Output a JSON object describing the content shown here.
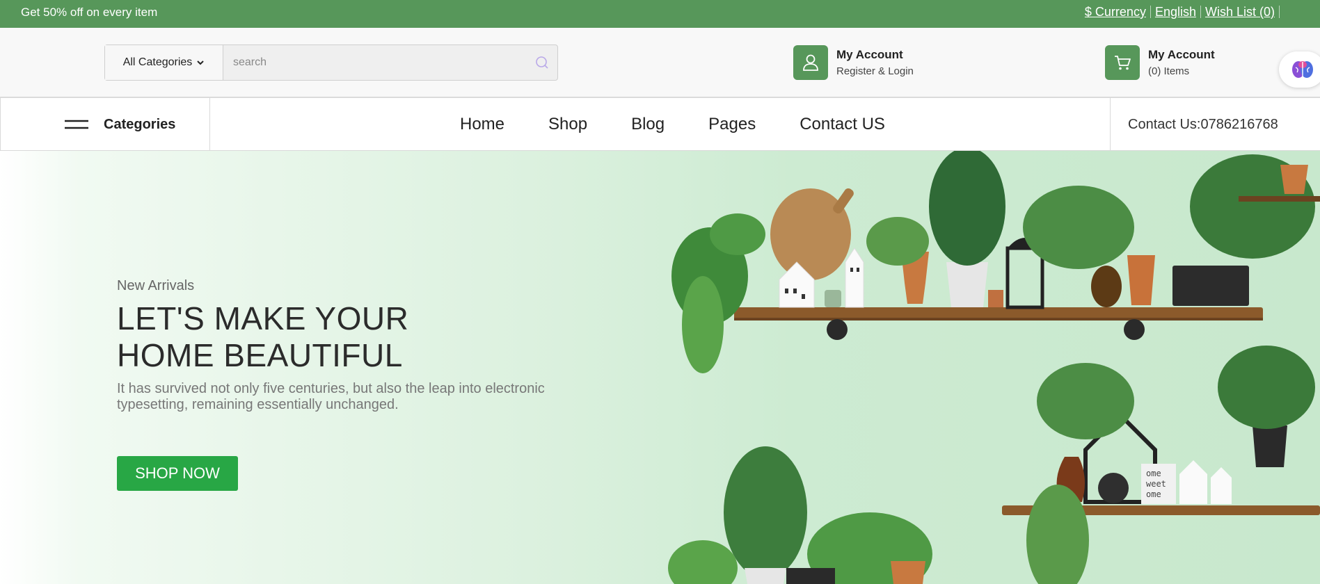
{
  "topbar": {
    "promo": "Get 50% off on every item",
    "links": [
      "$ Currency",
      "English",
      "Wish List (0)"
    ]
  },
  "header": {
    "search": {
      "category": "All Categories",
      "placeholder": "search"
    },
    "account": {
      "title": "My Account",
      "subtitle": "Register & Login"
    },
    "cart": {
      "title": "My Account",
      "subtitle": "(0) Items"
    }
  },
  "nav": {
    "categories_label": "Categories",
    "menu": [
      "Home",
      "Shop",
      "Blog",
      "Pages",
      "Contact US"
    ],
    "contact": "Contact Us:0786216768"
  },
  "hero": {
    "kicker": "New Arrivals",
    "title_line1": "LET'S MAKE YOUR",
    "title_line2": "HOME BEAUTIFUL",
    "description": "It has survived not only five centuries, but also the leap into electronic typesetting, remaining essentially unchanged.",
    "cta": "SHOP NOW",
    "sign_lines": [
      "ome",
      "weet",
      "ome"
    ]
  },
  "colors": {
    "brand_green": "#57975a",
    "cta_green": "#28a745",
    "hero_bg": "#c8e8cd"
  },
  "icons": {
    "search": "search-icon",
    "account": "user-icon",
    "cart": "cart-icon",
    "menu": "hamburger-icon",
    "dropdown": "chevron-down-icon",
    "assistant": "brain-icon"
  }
}
